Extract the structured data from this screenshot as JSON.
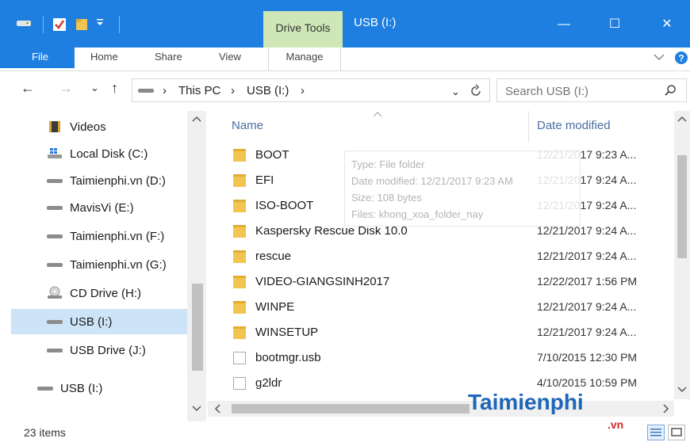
{
  "window": {
    "contextual_tab": "Drive Tools",
    "title": "USB (I:)",
    "minimize": "—",
    "maximize": "☐",
    "close": "✕"
  },
  "ribbon": {
    "tabs": [
      "File",
      "Home",
      "Share",
      "View",
      "Manage"
    ]
  },
  "address": {
    "crumbs": [
      "This PC",
      "USB (I:)"
    ],
    "search_placeholder": "Search USB (I:)"
  },
  "nav_pane": {
    "items": [
      {
        "label": "Videos",
        "icon": "videos-folder-icon",
        "selected": false
      },
      {
        "label": "Local Disk (C:)",
        "icon": "windows-drive-icon",
        "selected": false
      },
      {
        "label": "Taimienphi.vn (D:)",
        "icon": "drive-icon",
        "selected": false
      },
      {
        "label": "MavisVi (E:)",
        "icon": "drive-icon",
        "selected": false
      },
      {
        "label": "Taimienphi.vn (F:)",
        "icon": "drive-icon",
        "selected": false
      },
      {
        "label": "Taimienphi.vn (G:)",
        "icon": "drive-icon",
        "selected": false
      },
      {
        "label": "CD Drive (H:)",
        "icon": "cd-drive-icon",
        "selected": false
      },
      {
        "label": "USB (I:)",
        "icon": "usb-drive-icon",
        "selected": true
      },
      {
        "label": "USB Drive (J:)",
        "icon": "usb-drive-icon",
        "selected": false
      },
      {
        "label": "USB (I:)",
        "icon": "usb-drive-icon",
        "selected": false
      }
    ]
  },
  "columns": {
    "name": "Name",
    "date": "Date modified"
  },
  "files": [
    {
      "name": "BOOT",
      "date": "12/21/2017 9:23 A...",
      "type": "folder"
    },
    {
      "name": "EFI",
      "date": "12/21/2017 9:24 A...",
      "type": "folder"
    },
    {
      "name": "ISO-BOOT",
      "date": "12/21/2017 9:24 A...",
      "type": "folder"
    },
    {
      "name": "Kaspersky Rescue Disk 10.0",
      "date": "12/21/2017 9:24 A...",
      "type": "folder"
    },
    {
      "name": "rescue",
      "date": "12/21/2017 9:24 A...",
      "type": "folder"
    },
    {
      "name": "VIDEO-GIANGSINH2017",
      "date": "12/22/2017 1:56 PM",
      "type": "folder"
    },
    {
      "name": "WINPE",
      "date": "12/21/2017 9:24 A...",
      "type": "folder"
    },
    {
      "name": "WINSETUP",
      "date": "12/21/2017 9:24 A...",
      "type": "folder"
    },
    {
      "name": "bootmgr.usb",
      "date": "7/10/2015 12:30 PM",
      "type": "file"
    },
    {
      "name": "g2ldr",
      "date": "4/10/2015 10:59 PM",
      "type": "file"
    }
  ],
  "tooltip": {
    "type": "Type: File folder",
    "modified": "Date modified: 12/21/2017 9:23 AM",
    "size": "Size: 108 bytes",
    "files": "Files: khong_xoa_folder_nay"
  },
  "status": {
    "item_count": "23 items"
  },
  "watermark": {
    "main": "Taimienphi",
    "sub": ".vn"
  },
  "colors": {
    "titlebar": "#1e7fe0",
    "drive_tools_tab": "#cfe7b6",
    "selection": "#cde3f7",
    "column_header_text": "#4a6fa0",
    "folder": "#f2c451"
  }
}
